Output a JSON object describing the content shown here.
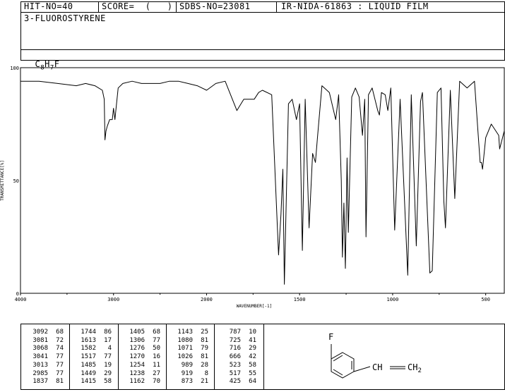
{
  "header": {
    "hit": "HIT-NO=40",
    "score": "SCORE=  (   )",
    "sdbs": "SDBS-NO=23081",
    "ir": "IR-NIDA-61863 : LIQUID FILM"
  },
  "compound": {
    "name": "3-FLUOROSTYRENE",
    "formula_c": "C",
    "formula_c_sub": "8",
    "formula_h": "H",
    "formula_h_sub": "7",
    "formula_f": "F"
  },
  "structure": {
    "fluorine": "F",
    "vinyl": "CH",
    "ch2": "CH",
    "ch2_sub": "2"
  },
  "chart_data": {
    "type": "line",
    "title": "",
    "xlabel": "WAVENUMBER[-1]",
    "ylabel": "TRANSMITTANCE[%]",
    "xlim": [
      4000,
      400
    ],
    "ylim": [
      0,
      100
    ],
    "x_ticks": [
      "4000",
      "3000",
      "2000",
      "1500",
      "1000",
      "500"
    ],
    "y_ticks": [
      "100",
      "50",
      "0"
    ],
    "grid": false,
    "series": [
      {
        "x": [
          4000,
          3800,
          3600,
          3400,
          3300,
          3200,
          3120,
          3100,
          3092,
          3081,
          3068,
          3041,
          3013,
          3000,
          2985,
          2950,
          2900,
          2800,
          2700,
          2600,
          2500,
          2400,
          2300,
          2200,
          2100,
          2000,
          1950,
          1900,
          1837,
          1800,
          1744,
          1720,
          1700,
          1650,
          1613,
          1600,
          1590,
          1582,
          1560,
          1540,
          1517,
          1500,
          1485,
          1470,
          1449,
          1430,
          1415,
          1405,
          1380,
          1340,
          1306,
          1290,
          1276,
          1270,
          1262,
          1254,
          1245,
          1238,
          1220,
          1200,
          1180,
          1162,
          1150,
          1143,
          1130,
          1110,
          1080,
          1071,
          1060,
          1040,
          1026,
          1010,
          989,
          960,
          919,
          900,
          873,
          850,
          840,
          800,
          787,
          760,
          740,
          725,
          716,
          690,
          666,
          640,
          600,
          560,
          540,
          530,
          523,
          517,
          500,
          470,
          430,
          425,
          400
        ],
        "y": [
          94,
          94,
          93,
          92,
          93,
          92,
          90,
          86,
          68,
          72,
          74,
          77,
          77,
          82,
          77,
          91,
          93,
          94,
          93,
          93,
          93,
          94,
          94,
          93,
          92,
          90,
          93,
          94,
          81,
          86,
          86,
          89,
          90,
          88,
          17,
          35,
          55,
          4,
          84,
          86,
          77,
          84,
          19,
          86,
          29,
          62,
          58,
          68,
          92,
          89,
          77,
          88,
          50,
          16,
          40,
          11,
          60,
          27,
          87,
          91,
          87,
          70,
          86,
          25,
          88,
          91,
          81,
          79,
          89,
          88,
          81,
          91,
          28,
          86,
          8,
          88,
          21,
          85,
          89,
          9,
          10,
          89,
          91,
          41,
          29,
          90,
          42,
          94,
          91,
          94,
          70,
          58,
          58,
          55,
          69,
          75,
          70,
          64,
          72
        ]
      }
    ]
  },
  "peak_table": {
    "columns": [
      {
        "wn": [
          "3092",
          "3081",
          "3068",
          "3041",
          "3013",
          "2985",
          "1837"
        ],
        "t": [
          "68",
          "72",
          "74",
          "77",
          "77",
          "77",
          "81"
        ]
      },
      {
        "wn": [
          "1744",
          "1613",
          "1582",
          "1517",
          "1485",
          "1449",
          "1415"
        ],
        "t": [
          "86",
          "17",
          "4",
          "77",
          "19",
          "29",
          "58"
        ]
      },
      {
        "wn": [
          "1405",
          "1306",
          "1276",
          "1270",
          "1254",
          "1238",
          "1162"
        ],
        "t": [
          "68",
          "77",
          "50",
          "16",
          "11",
          "27",
          "70"
        ]
      },
      {
        "wn": [
          "1143",
          "1080",
          "1071",
          "1026",
          "989",
          "919",
          "873"
        ],
        "t": [
          "25",
          "81",
          "79",
          "81",
          "28",
          "8",
          "21"
        ]
      },
      {
        "wn": [
          "787",
          "725",
          "716",
          "666",
          "523",
          "517",
          "425"
        ],
        "t": [
          "10",
          "41",
          "29",
          "42",
          "58",
          "55",
          "64"
        ]
      }
    ]
  }
}
